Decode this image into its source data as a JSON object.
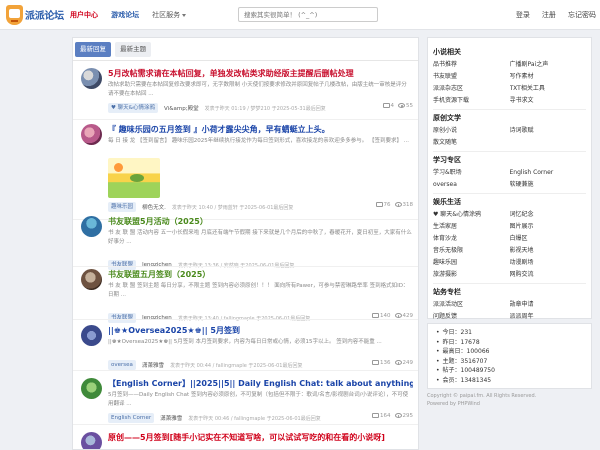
{
  "header": {
    "logo_text": "派派论坛",
    "nav": [
      {
        "label": "用户中心",
        "style": "red"
      },
      {
        "label": "游戏论坛",
        "style": "blue"
      },
      {
        "label": "社区服务",
        "style": "plain"
      }
    ],
    "search_placeholder": "搜索其实很简单！ (^_^)",
    "right_links": [
      "登录",
      "注册",
      "忘记密码"
    ]
  },
  "tabs": [
    "最新回复",
    "最新主题"
  ],
  "posts": [
    {
      "title": "5月改帖需求请在本帖回复，单独发改帖类求助经版主提醒后删帖处理",
      "title_color": "red",
      "excerpt": "改帖求助只需要在本帖回复修改要求即可，无字数限制 小天使们按要求修改并原回复帖子几楼改帖，由版主统一审核是评分 请不要在本帖回 ...",
      "tag": "♥ 聊天&心情涂鸦",
      "author": "Vi&amp;殿堂",
      "info": "发表于昨天 01:19 / 梦梦210 于2025-05-31最后回复",
      "comments": "4",
      "views": "55",
      "has_thumb": false
    },
    {
      "title": "『 趣味乐园の五月签到 』小荷才露尖尖角，早有蜻蜓立上头。",
      "title_color": "blue",
      "excerpt": "每 日 接 龙 【签到留言】 趣味乐园2025年继续执行接龙作为每日签到形式，喜欢接龙的亲欢迎多多参与。 【签到要求】 ...",
      "tag": "趣味乐园",
      "author": "柳色无文.",
      "info": "发表于昨天 10:40 / 梦雨蓝轩 于2025-06-01最后回复",
      "comments": "76",
      "views": "318",
      "has_thumb": true
    },
    {
      "title": "书友联盟5月活动（2025）",
      "title_color": "green",
      "excerpt": "书 友 联 盟 活动内容 五一小长假来啦 月底还有端午节假期 接下来就是几个月后的中秋了，春暖花开，夏日初至，大家有什么好事分 ...",
      "tag": "书友联盟",
      "author": "lengzichen",
      "info": "发表于昨天 13:36 / 安然晓 于2025-06-01最后回复",
      "comments": "",
      "views": "",
      "has_thumb": false
    },
    {
      "title": "书友联盟五月签到（2025）",
      "title_color": "green",
      "excerpt": "书 友 联 盟 签到主题 每日分享，不限主题 签到内容必须原创！！！ 面向所有Pawer，可参与禁密琳路举率 签到格式如ID： 日期 ...",
      "tag": "书友联盟",
      "author": "lengzichen",
      "info": "发表于昨天 13:40 / fallingmaple 于2025-06-01最后回复",
      "comments": "140",
      "views": "429",
      "has_thumb": false
    },
    {
      "title": "||♚★Oversea2025★♚|| 5月签到",
      "title_color": "blue",
      "excerpt": "||♚★Oversea2025★♚|| 5月签到 本月签到要求，内容为每日日常或心情，必须15字以上。 签到内容不能重 ...",
      "tag": "oversea",
      "author": "潇萧雅雪",
      "info": "发表于昨天 00:44 / fallingmaple 于2025-06-01最后回复",
      "comments": "136",
      "views": "249",
      "has_thumb": false
    },
    {
      "title": "【English Corner】||2025||5|| Daily English Chat: talk about anything you want",
      "title_color": "blue",
      "excerpt": "5月签到——Daily English Chat 签到内容必须原创，不可复制（包括但不限于：歌词/名言/影视剧台词/小说评论），不可使用翻译 ...",
      "tag": "English Corner",
      "author": "潇萧雅雪",
      "info": "发表于昨天 00:46 / fallingmaple 于2025-06-01最后回复",
      "comments": "164",
      "views": "295",
      "has_thumb": false
    },
    {
      "title": "原创——5月签到[随手小记实在不知道写啥，可以试试写吃的和在看的小说呀]",
      "title_color": "orange",
      "excerpt": "",
      "tag": "",
      "author": "",
      "info": "",
      "comments": "",
      "views": "",
      "has_thumb": false
    }
  ],
  "sidebar": {
    "sections": [
      {
        "heading": "小说相关",
        "items": [
          "品书推荐",
          "广播剧Pai之声",
          "书友联盟",
          "写作素材",
          "派派杂志区",
          "TXT相关工具",
          "手机资源下载",
          "寻书求文"
        ]
      },
      {
        "heading": "原创文学",
        "items": [
          "原创小说",
          "诗词歌赋",
          "散文随笔"
        ]
      },
      {
        "heading": "学习专区",
        "items": [
          "学习&职场",
          "English Corner",
          "oversea",
          "软硬兼施"
        ]
      },
      {
        "heading": "娱乐生活",
        "items": [
          "♥ 聊天&心情涂鸦",
          "词忆纪念",
          "生活家居",
          "图片展示",
          "体育沙龙",
          "白爆区",
          "音乐无极限",
          "影视天地",
          "趣味乐园",
          "动漫剧场",
          "旅游摄影",
          "网购交流"
        ]
      },
      {
        "heading": "站务专栏",
        "items": [
          "派派活动区",
          "勋章申请",
          "问题反馈",
          "派派周年"
        ]
      }
    ],
    "stats": [
      "今日：231",
      "昨日：17678",
      "最高日：100066",
      "主题：3516707",
      "帖子：100489750",
      "会员：13481345"
    ],
    "footer": [
      "Copyright © paipai.fm. All Rights Reserved.",
      "Powered by PHPWind"
    ]
  }
}
